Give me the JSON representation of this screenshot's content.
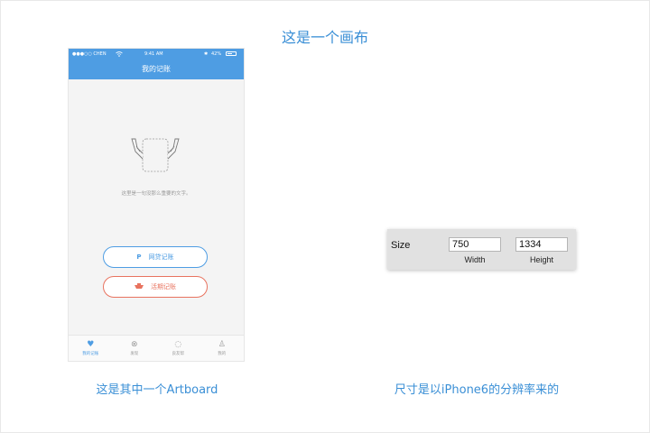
{
  "page": {
    "title": "这是一个画布",
    "caption_left": "这是其中一个Artboard",
    "caption_right": "尺寸是以iPhone6的分辨率来的"
  },
  "phone": {
    "status": {
      "carrier": "●●●○○ CHEN",
      "wifi_icon": "wifi-icon",
      "time": "9:41 AM",
      "bluetooth_icon": "bluetooth-icon",
      "battery_pct": "42%"
    },
    "nav_title": "我的记账",
    "empty_text": "这里是一句没那么重要的文字。",
    "buttons": [
      {
        "icon": "P",
        "icon_name": "paypal-icon",
        "label": "网贷记账",
        "color": "#4e9de3"
      },
      {
        "icon": "▬",
        "icon_name": "boat-icon",
        "label": "活期记账",
        "color": "#e8735f"
      }
    ],
    "tabs": [
      {
        "icon": "♥",
        "icon_name": "heart-icon",
        "label": "我的记账",
        "active": true
      },
      {
        "icon": "⊗",
        "icon_name": "discover-icon",
        "label": "发现",
        "active": false
      },
      {
        "icon": "◌",
        "icon_name": "chat-icon",
        "label": "良友帮",
        "active": false
      },
      {
        "icon": "♙",
        "icon_name": "user-icon",
        "label": "我的",
        "active": false
      }
    ]
  },
  "size_panel": {
    "label": "Size",
    "width_value": "750",
    "height_value": "1334",
    "width_caption": "Width",
    "height_caption": "Height"
  },
  "colors": {
    "accent": "#3a8fd6",
    "navbar": "#4e9de3",
    "danger": "#e8735f"
  }
}
